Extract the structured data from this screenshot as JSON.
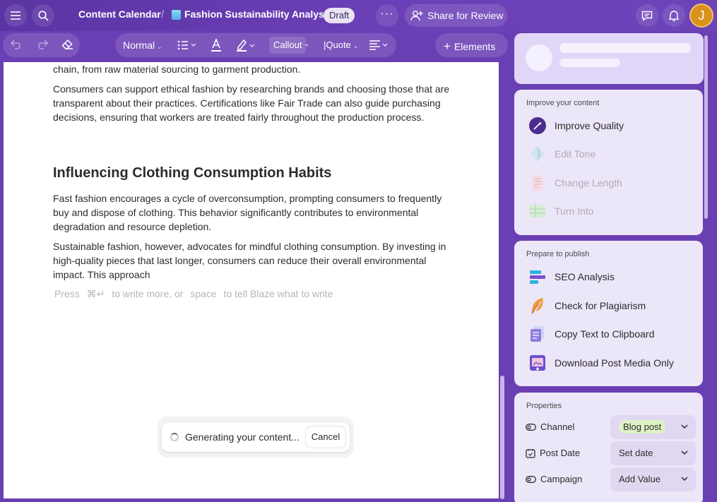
{
  "header": {
    "breadcrumb_root": "Content Calendar",
    "doc_title": "Fashion Sustainability Analysis",
    "draft_badge": "Draft",
    "more_label": "···",
    "share_label": "Share for Review",
    "avatar_initial": "J"
  },
  "toolbar": {
    "style_select": "Normal",
    "callout": "Callout",
    "quote": "|Quote",
    "elements_label": "Elements"
  },
  "editor": {
    "para1": "chain, from raw material sourcing to garment production.",
    "para2": "Consumers can support ethical fashion by researching brands and choosing those that are transparent about their practices. Certifications like Fair Trade can also guide purchasing decisions, ensuring that workers are treated fairly throughout the production process.",
    "heading": "Influencing Clothing Consumption Habits",
    "para3": "Fast fashion encourages a cycle of overconsumption, prompting consumers to frequently buy and dispose of clothing. This behavior significantly contributes to environmental degradation and resource depletion.",
    "para4": "Sustainable fashion, however, advocates for mindful clothing consumption. By investing in high-quality pieces that last longer, consumers can reduce their overall environmental impact. This approach",
    "hint_press": "Press",
    "hint_key1": "⌘↵",
    "hint_mid": "to write more, or",
    "hint_key2": "space",
    "hint_end": "to tell Blaze what to write",
    "generating": "Generating your content...",
    "cancel": "Cancel"
  },
  "improve": {
    "title": "Improve your content",
    "items": [
      {
        "label": "Improve Quality"
      },
      {
        "label": "Edit Tone"
      },
      {
        "label": "Change Length"
      },
      {
        "label": "Turn Into"
      }
    ]
  },
  "publish": {
    "title": "Prepare to publish",
    "items": [
      {
        "label": "SEO Analysis"
      },
      {
        "label": "Check for Plagiarism"
      },
      {
        "label": "Copy Text to Clipboard"
      },
      {
        "label": "Download Post Media Only"
      }
    ]
  },
  "properties": {
    "title": "Properties",
    "rows": [
      {
        "label": "Channel",
        "value": "Blog post"
      },
      {
        "label": "Post Date",
        "value": "Set date"
      },
      {
        "label": "Campaign",
        "value": "Add Value"
      }
    ]
  },
  "colors": {
    "header_bg": "#6b3fb6",
    "panel_bg": "#ece6f9",
    "chip_green": "#dff2c6",
    "avatar": "#d9921a"
  }
}
